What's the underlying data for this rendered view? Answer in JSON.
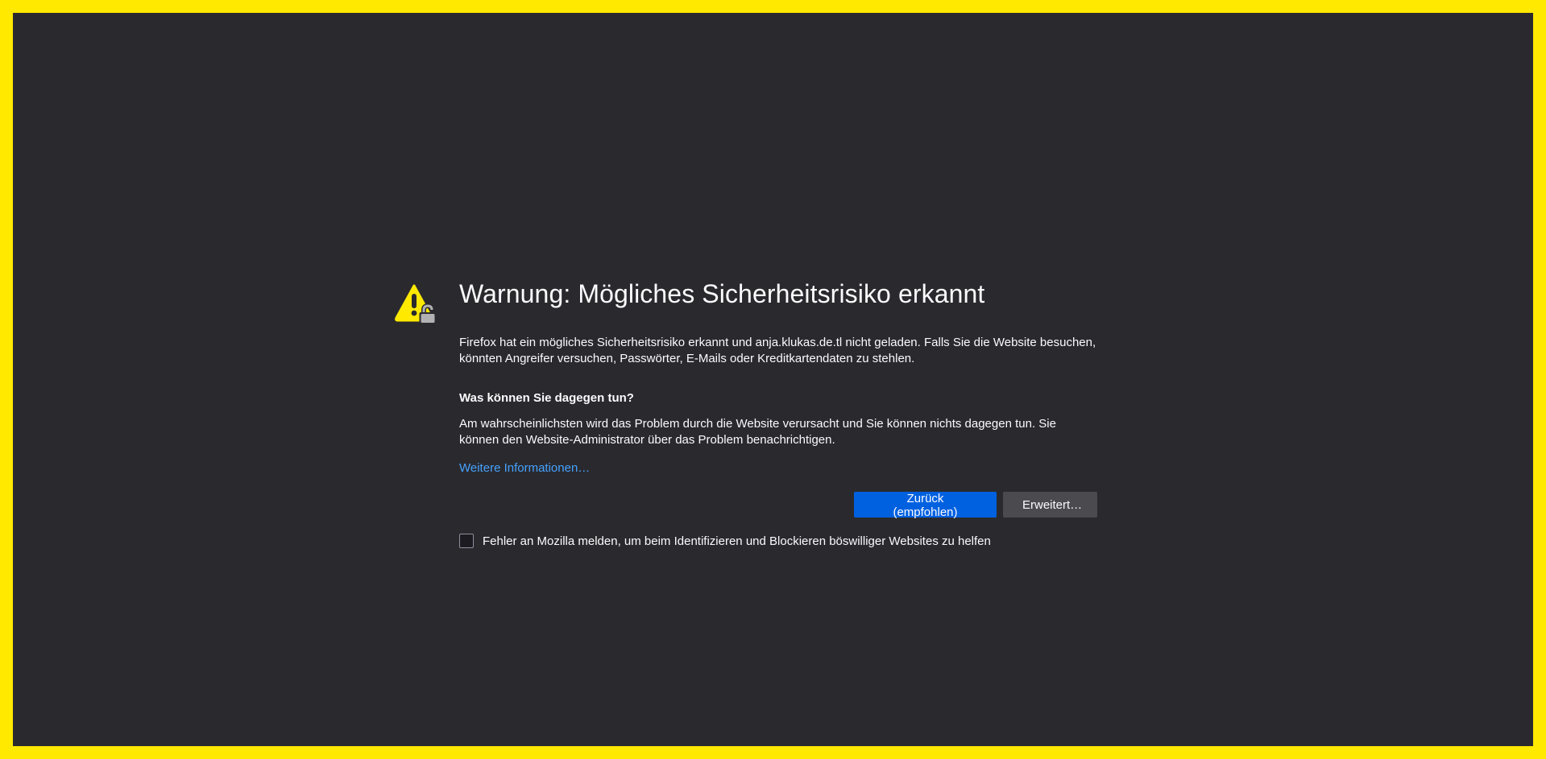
{
  "page": {
    "border_color": "#ffe900",
    "background_color": "#2a2a2e",
    "accent_color": "#0061e0",
    "link_color": "#45a1ff"
  },
  "icon": {
    "name": "warning-lock-icon"
  },
  "error": {
    "title": "Warnung: Mögliches Sicherheitsrisiko erkannt",
    "description": "Firefox hat ein mögliches Sicherheitsrisiko erkannt und anja.klukas.de.tl nicht geladen. Falls Sie die Website besuchen, könnten Angreifer versuchen, Passwörter, E-Mails oder Kreditkartendaten zu stehlen.",
    "what_to_do_heading": "Was können Sie dagegen tun?",
    "what_to_do_text": "Am wahrscheinlichsten wird das Problem durch die Website verursacht und Sie können nichts dagegen tun. Sie können den Website-Administrator über das Problem benachrichtigen.",
    "learn_more_link": "Weitere Informationen…"
  },
  "buttons": {
    "back_label": "Zurück (empfohlen)",
    "advanced_label": "Erweitert…"
  },
  "report": {
    "checked": false,
    "label": "Fehler an Mozilla melden, um beim Identifizieren und Blockieren böswilliger Websites zu helfen"
  }
}
